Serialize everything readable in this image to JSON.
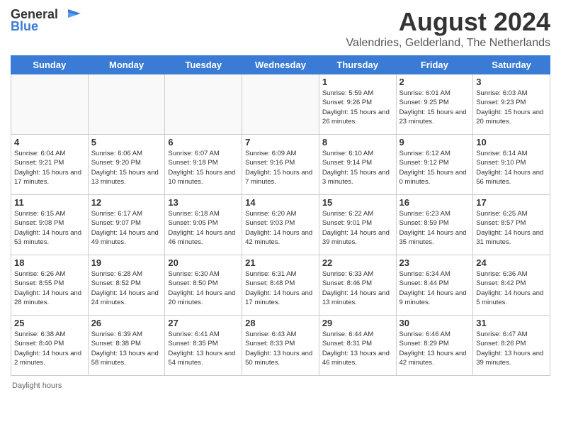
{
  "logo": {
    "general": "General",
    "blue": "Blue"
  },
  "title": "August 2024",
  "location": "Valendries, Gelderland, The Netherlands",
  "days_of_week": [
    "Sunday",
    "Monday",
    "Tuesday",
    "Wednesday",
    "Thursday",
    "Friday",
    "Saturday"
  ],
  "footer": "Daylight hours",
  "weeks": [
    [
      {
        "day": "",
        "sunrise": "",
        "sunset": "",
        "daylight": ""
      },
      {
        "day": "",
        "sunrise": "",
        "sunset": "",
        "daylight": ""
      },
      {
        "day": "",
        "sunrise": "",
        "sunset": "",
        "daylight": ""
      },
      {
        "day": "",
        "sunrise": "",
        "sunset": "",
        "daylight": ""
      },
      {
        "day": "1",
        "sunrise": "Sunrise: 5:59 AM",
        "sunset": "Sunset: 9:26 PM",
        "daylight": "Daylight: 15 hours and 26 minutes."
      },
      {
        "day": "2",
        "sunrise": "Sunrise: 6:01 AM",
        "sunset": "Sunset: 9:25 PM",
        "daylight": "Daylight: 15 hours and 23 minutes."
      },
      {
        "day": "3",
        "sunrise": "Sunrise: 6:03 AM",
        "sunset": "Sunset: 9:23 PM",
        "daylight": "Daylight: 15 hours and 20 minutes."
      }
    ],
    [
      {
        "day": "4",
        "sunrise": "Sunrise: 6:04 AM",
        "sunset": "Sunset: 9:21 PM",
        "daylight": "Daylight: 15 hours and 17 minutes."
      },
      {
        "day": "5",
        "sunrise": "Sunrise: 6:06 AM",
        "sunset": "Sunset: 9:20 PM",
        "daylight": "Daylight: 15 hours and 13 minutes."
      },
      {
        "day": "6",
        "sunrise": "Sunrise: 6:07 AM",
        "sunset": "Sunset: 9:18 PM",
        "daylight": "Daylight: 15 hours and 10 minutes."
      },
      {
        "day": "7",
        "sunrise": "Sunrise: 6:09 AM",
        "sunset": "Sunset: 9:16 PM",
        "daylight": "Daylight: 15 hours and 7 minutes."
      },
      {
        "day": "8",
        "sunrise": "Sunrise: 6:10 AM",
        "sunset": "Sunset: 9:14 PM",
        "daylight": "Daylight: 15 hours and 3 minutes."
      },
      {
        "day": "9",
        "sunrise": "Sunrise: 6:12 AM",
        "sunset": "Sunset: 9:12 PM",
        "daylight": "Daylight: 15 hours and 0 minutes."
      },
      {
        "day": "10",
        "sunrise": "Sunrise: 6:14 AM",
        "sunset": "Sunset: 9:10 PM",
        "daylight": "Daylight: 14 hours and 56 minutes."
      }
    ],
    [
      {
        "day": "11",
        "sunrise": "Sunrise: 6:15 AM",
        "sunset": "Sunset: 9:08 PM",
        "daylight": "Daylight: 14 hours and 53 minutes."
      },
      {
        "day": "12",
        "sunrise": "Sunrise: 6:17 AM",
        "sunset": "Sunset: 9:07 PM",
        "daylight": "Daylight: 14 hours and 49 minutes."
      },
      {
        "day": "13",
        "sunrise": "Sunrise: 6:18 AM",
        "sunset": "Sunset: 9:05 PM",
        "daylight": "Daylight: 14 hours and 46 minutes."
      },
      {
        "day": "14",
        "sunrise": "Sunrise: 6:20 AM",
        "sunset": "Sunset: 9:03 PM",
        "daylight": "Daylight: 14 hours and 42 minutes."
      },
      {
        "day": "15",
        "sunrise": "Sunrise: 6:22 AM",
        "sunset": "Sunset: 9:01 PM",
        "daylight": "Daylight: 14 hours and 39 minutes."
      },
      {
        "day": "16",
        "sunrise": "Sunrise: 6:23 AM",
        "sunset": "Sunset: 8:59 PM",
        "daylight": "Daylight: 14 hours and 35 minutes."
      },
      {
        "day": "17",
        "sunrise": "Sunrise: 6:25 AM",
        "sunset": "Sunset: 8:57 PM",
        "daylight": "Daylight: 14 hours and 31 minutes."
      }
    ],
    [
      {
        "day": "18",
        "sunrise": "Sunrise: 6:26 AM",
        "sunset": "Sunset: 8:55 PM",
        "daylight": "Daylight: 14 hours and 28 minutes."
      },
      {
        "day": "19",
        "sunrise": "Sunrise: 6:28 AM",
        "sunset": "Sunset: 8:52 PM",
        "daylight": "Daylight: 14 hours and 24 minutes."
      },
      {
        "day": "20",
        "sunrise": "Sunrise: 6:30 AM",
        "sunset": "Sunset: 8:50 PM",
        "daylight": "Daylight: 14 hours and 20 minutes."
      },
      {
        "day": "21",
        "sunrise": "Sunrise: 6:31 AM",
        "sunset": "Sunset: 8:48 PM",
        "daylight": "Daylight: 14 hours and 17 minutes."
      },
      {
        "day": "22",
        "sunrise": "Sunrise: 6:33 AM",
        "sunset": "Sunset: 8:46 PM",
        "daylight": "Daylight: 14 hours and 13 minutes."
      },
      {
        "day": "23",
        "sunrise": "Sunrise: 6:34 AM",
        "sunset": "Sunset: 8:44 PM",
        "daylight": "Daylight: 14 hours and 9 minutes."
      },
      {
        "day": "24",
        "sunrise": "Sunrise: 6:36 AM",
        "sunset": "Sunset: 8:42 PM",
        "daylight": "Daylight: 14 hours and 5 minutes."
      }
    ],
    [
      {
        "day": "25",
        "sunrise": "Sunrise: 6:38 AM",
        "sunset": "Sunset: 8:40 PM",
        "daylight": "Daylight: 14 hours and 2 minutes."
      },
      {
        "day": "26",
        "sunrise": "Sunrise: 6:39 AM",
        "sunset": "Sunset: 8:38 PM",
        "daylight": "Daylight: 13 hours and 58 minutes."
      },
      {
        "day": "27",
        "sunrise": "Sunrise: 6:41 AM",
        "sunset": "Sunset: 8:35 PM",
        "daylight": "Daylight: 13 hours and 54 minutes."
      },
      {
        "day": "28",
        "sunrise": "Sunrise: 6:43 AM",
        "sunset": "Sunset: 8:33 PM",
        "daylight": "Daylight: 13 hours and 50 minutes."
      },
      {
        "day": "29",
        "sunrise": "Sunrise: 6:44 AM",
        "sunset": "Sunset: 8:31 PM",
        "daylight": "Daylight: 13 hours and 46 minutes."
      },
      {
        "day": "30",
        "sunrise": "Sunrise: 6:46 AM",
        "sunset": "Sunset: 8:29 PM",
        "daylight": "Daylight: 13 hours and 42 minutes."
      },
      {
        "day": "31",
        "sunrise": "Sunrise: 6:47 AM",
        "sunset": "Sunset: 8:26 PM",
        "daylight": "Daylight: 13 hours and 39 minutes."
      }
    ]
  ]
}
